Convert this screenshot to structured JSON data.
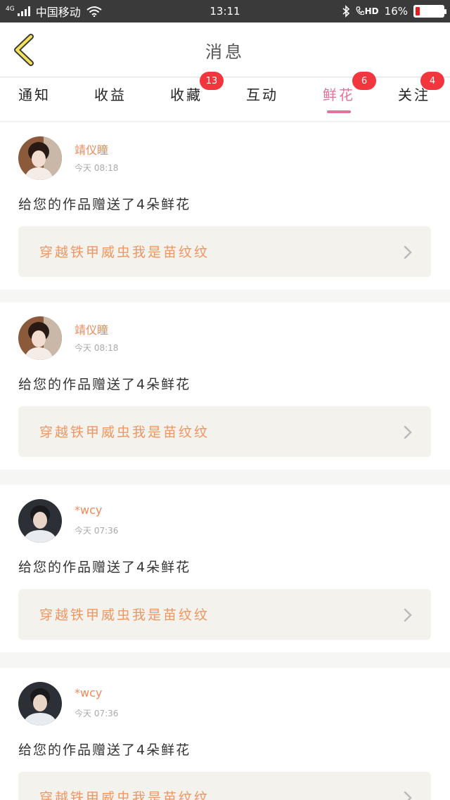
{
  "status_bar": {
    "network": "4G",
    "carrier": "中国移动",
    "time": "13:11",
    "hd": "HD",
    "battery_percent": "16%",
    "battery_level": 0.16
  },
  "header": {
    "title": "消息"
  },
  "tabs": [
    {
      "label": "通知",
      "badge": ""
    },
    {
      "label": "收益",
      "badge": ""
    },
    {
      "label": "收藏",
      "badge": "13"
    },
    {
      "label": "互动",
      "badge": ""
    },
    {
      "label": "鲜花",
      "badge": "6",
      "active": true
    },
    {
      "label": "关注",
      "badge": "4"
    }
  ],
  "messages": [
    {
      "user": "靖仪瞳",
      "time": "今天 08:18",
      "text": "给您的作品赠送了4朵鲜花",
      "work": "穿越铁甲威虫我是苗纹纹",
      "avatar": "female-avatar"
    },
    {
      "user": "靖仪瞳",
      "time": "今天 08:18",
      "text": "给您的作品赠送了4朵鲜花",
      "work": "穿越铁甲威虫我是苗纹纹",
      "avatar": "female-avatar"
    },
    {
      "user": "*wcy",
      "time": "今天 07:36",
      "text": "给您的作品赠送了4朵鲜花",
      "work": "穿越铁甲威虫我是苗纹纹",
      "avatar": "male-avatar"
    },
    {
      "user": "*wcy",
      "time": "今天 07:36",
      "text": "给您的作品赠送了4朵鲜花",
      "work": "穿越铁甲威虫我是苗纹纹",
      "avatar": "male-avatar"
    }
  ],
  "colors": {
    "accent": "#e8709a",
    "badge": "#f2363d",
    "username": "#f0895b",
    "work_title": "#f09663"
  }
}
